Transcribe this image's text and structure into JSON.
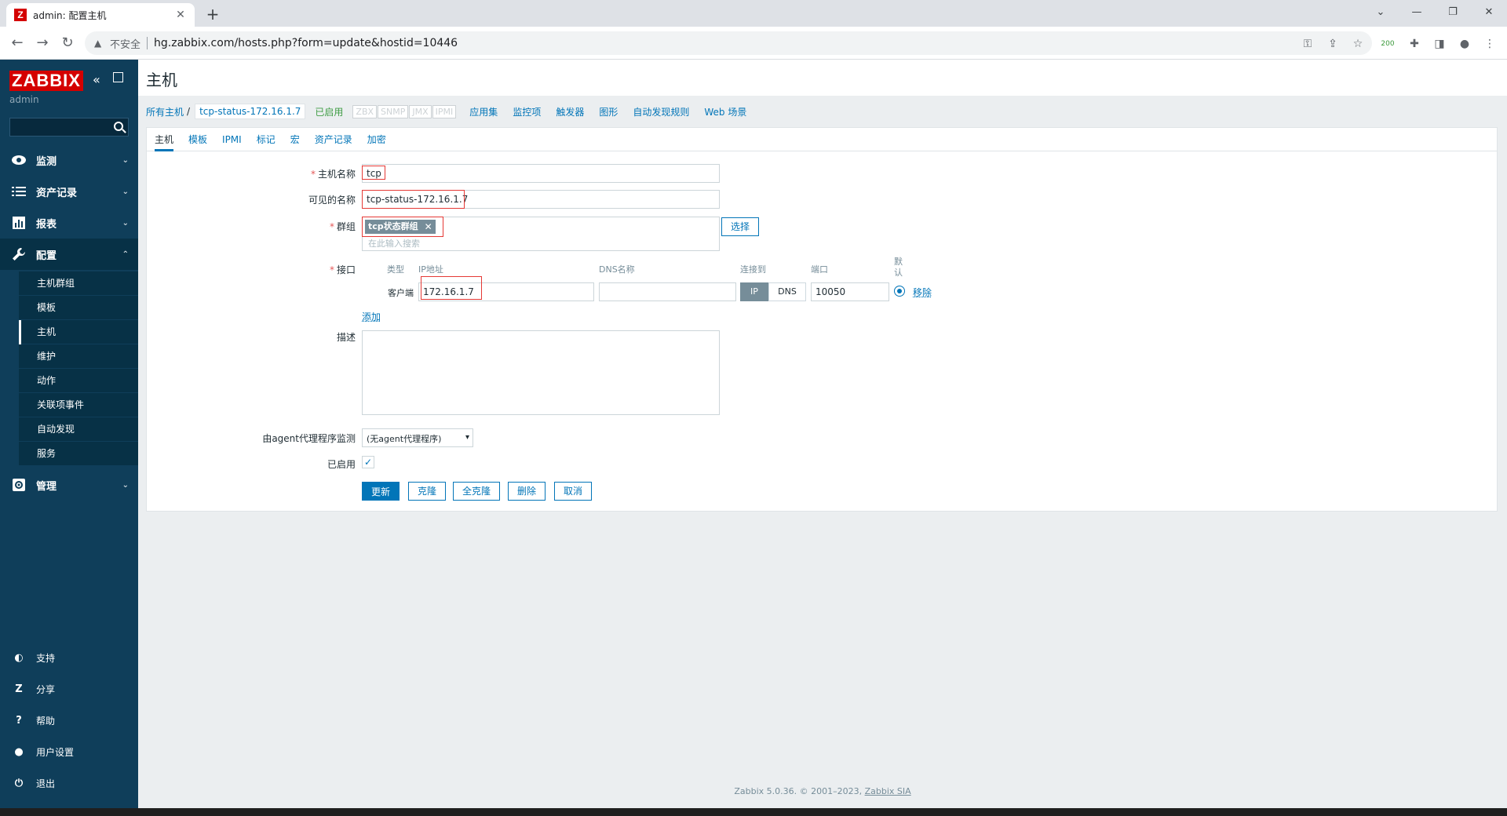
{
  "browser": {
    "tab_title": "admin: 配置主机",
    "favicon_letter": "Z",
    "not_secure": "不安全",
    "url": "hg.zabbix.com/hosts.php?form=update&hostid=10446",
    "ext_badge": "200"
  },
  "sidebar": {
    "logo": "ZABBIX",
    "user": "admin",
    "menu": [
      {
        "label": "监测",
        "icon": "eye-icon"
      },
      {
        "label": "资产记录",
        "icon": "list-icon"
      },
      {
        "label": "报表",
        "icon": "chart-icon"
      },
      {
        "label": "配置",
        "icon": "wrench-icon"
      },
      {
        "label": "管理",
        "icon": "gear-icon"
      }
    ],
    "submenu": [
      "主机群组",
      "模板",
      "主机",
      "维护",
      "动作",
      "关联项事件",
      "自动发现",
      "服务"
    ],
    "bottom": [
      {
        "label": "支持",
        "icon": "headset-icon",
        "glyph": "◐"
      },
      {
        "label": "分享",
        "icon": "share-z-icon",
        "glyph": "Z"
      },
      {
        "label": "帮助",
        "icon": "help-icon",
        "glyph": "?"
      },
      {
        "label": "用户设置",
        "icon": "user-icon",
        "glyph": "●"
      },
      {
        "label": "退出",
        "icon": "power-icon",
        "glyph": "⏻"
      }
    ]
  },
  "page": {
    "title": "主机"
  },
  "breadcrumbs": {
    "all_hosts": "所有主机",
    "slash": "/",
    "current": "tcp-status-172.16.1.7",
    "status": "已启用",
    "availability": [
      "ZBX",
      "SNMP",
      "JMX",
      "IPMI"
    ],
    "nav": [
      "应用集",
      "监控项",
      "触发器",
      "图形",
      "自动发现规则",
      "Web 场景"
    ]
  },
  "tabs": [
    "主机",
    "模板",
    "IPMI",
    "标记",
    "宏",
    "资产记录",
    "加密"
  ],
  "form": {
    "host_name_label": "主机名称",
    "host_name": "tcp",
    "visible_name_label": "可见的名称",
    "visible_name": "tcp-status-172.16.1.7",
    "groups_label": "群组",
    "group_tag": "tcp状态群组",
    "groups_placeholder": "在此输入搜索",
    "select_button": "选择",
    "interfaces_label": "接口",
    "col_type": "类型",
    "col_ip": "IP地址",
    "col_dns": "DNS名称",
    "col_connect": "连接到",
    "col_port": "端口",
    "col_default": "默认",
    "iface_type": "客户端",
    "iface_ip": "172.16.1.7",
    "iface_dns": "",
    "connect_ip": "IP",
    "connect_dns": "DNS",
    "iface_port": "10050",
    "remove_link": "移除",
    "add_link": "添加",
    "description_label": "描述",
    "proxy_label": "由agent代理程序监测",
    "proxy_value": "(无agent代理程序)",
    "enabled_label": "已启用",
    "enabled": true,
    "buttons": {
      "update": "更新",
      "clone": "克隆",
      "full_clone": "全克隆",
      "delete": "删除",
      "cancel": "取消"
    }
  },
  "footer": {
    "text": "Zabbix 5.0.36. © 2001–2023, ",
    "link": "Zabbix SIA"
  }
}
